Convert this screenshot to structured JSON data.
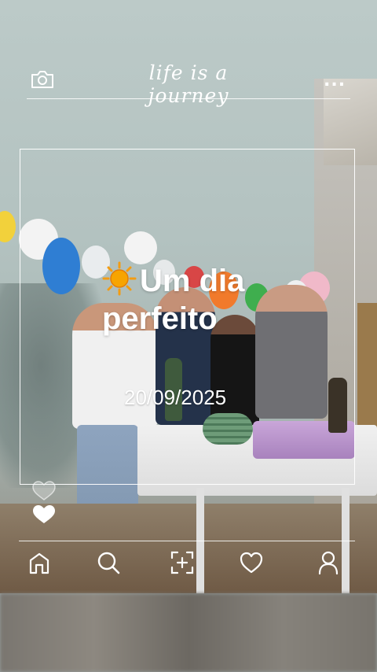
{
  "header": {
    "title": "life is a journey",
    "camera_icon": "camera-icon",
    "more_icon": "more-dots-icon",
    "more_label": "..."
  },
  "post": {
    "caption_emoji": "sun-emoji",
    "caption": "Um dia perfeito",
    "date": "20/09/2025"
  },
  "likes": {
    "icons": [
      "heart-outline-icon",
      "heart-filled-icon"
    ]
  },
  "bottom_nav": {
    "items": [
      "home-icon",
      "search-icon",
      "add-icon",
      "heart-icon",
      "profile-icon"
    ]
  },
  "colors": {
    "overlay": "#ffffff",
    "sun": "#f7a400"
  }
}
